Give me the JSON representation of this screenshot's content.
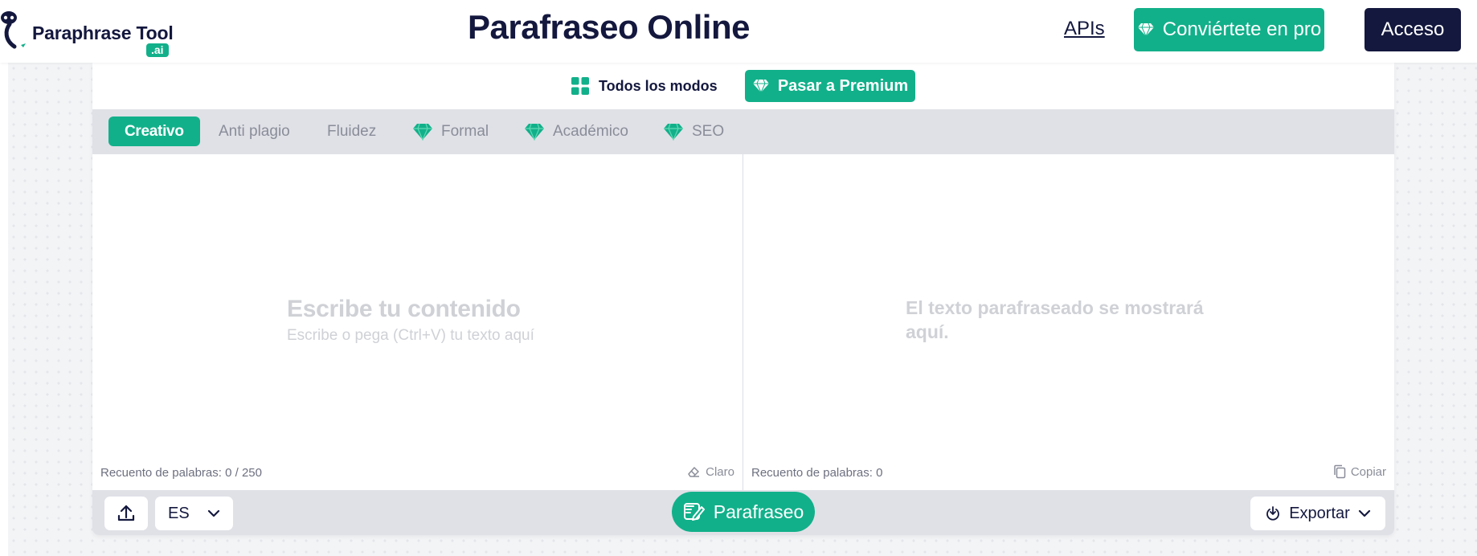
{
  "header": {
    "logo_text": "Paraphrase Tool",
    "logo_badge": ".ai",
    "title": "Parafraseo Online",
    "apis_label": "APIs",
    "pro_label": "Conviértete en pro",
    "login_label": "Acceso"
  },
  "toolbar": {
    "all_modes_label": "Todos los modos",
    "premium_label": "Pasar a Premium"
  },
  "modes": [
    {
      "label": "Creativo",
      "active": true,
      "premium": false
    },
    {
      "label": "Anti plagio",
      "active": false,
      "premium": false
    },
    {
      "label": "Fluidez",
      "active": false,
      "premium": false
    },
    {
      "label": "Formal",
      "active": false,
      "premium": true
    },
    {
      "label": "Académico",
      "active": false,
      "premium": true
    },
    {
      "label": "SEO",
      "active": false,
      "premium": true
    }
  ],
  "input_pane": {
    "placeholder_title": "Escribe tu contenido",
    "placeholder_subtitle": "Escribe o pega (Ctrl+V) tu texto aquí",
    "word_count": "Recuento de palabras: 0 / 250",
    "clear_label": "Claro"
  },
  "output_pane": {
    "placeholder": "El texto parafraseado se mostrará aquí.",
    "word_count": "Recuento de palabras: 0",
    "copy_label": "Copiar"
  },
  "bottom_bar": {
    "language": "ES",
    "paraphrase_label": "Parafraseo",
    "export_label": "Exportar"
  },
  "colors": {
    "accent": "#12b08a",
    "navy": "#14183e",
    "bar_bg": "#e0e1e7"
  },
  "icons": {
    "logo": "robot-hook-icon",
    "gem": "diamond-icon",
    "grid": "grid-icon",
    "eraser": "eraser-icon",
    "copy": "copy-icon",
    "upload": "upload-icon",
    "chevron": "chevron-down-icon",
    "paraphrase": "pen-icon",
    "export": "power-download-icon"
  }
}
